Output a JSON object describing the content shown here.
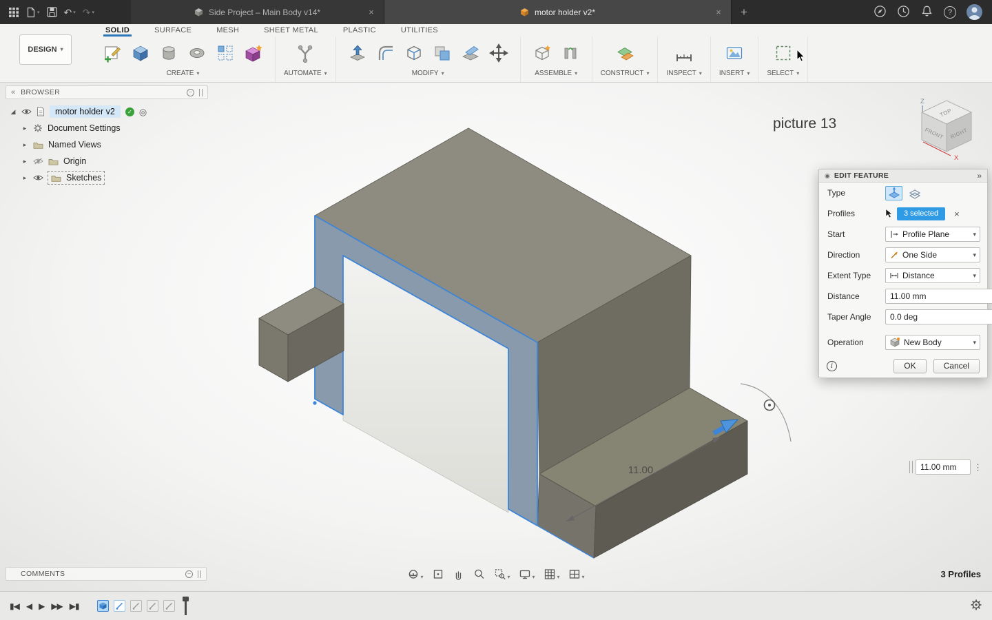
{
  "colors": {
    "accent": "#3c85d9",
    "selection_blue": "#2e9be4"
  },
  "glyphs": {
    "caret": "▾",
    "caret_right": "▸",
    "root_caret": "◢",
    "close": "×",
    "collapse_left": "«",
    "collapse_right": "»",
    "drag_dots": "⋮",
    "target": "◎",
    "check": "✓",
    "plus": "+",
    "help": "?",
    "undo": "↶",
    "redo": "↷",
    "record": "◉",
    "minus": "–"
  },
  "titlebar": {
    "tabs": [
      {
        "title": "Side Project – Main Body v14*"
      },
      {
        "title": "motor holder v2*"
      }
    ]
  },
  "ribbon": {
    "mode": "DESIGN",
    "tabs": [
      "SOLID",
      "SURFACE",
      "MESH",
      "SHEET METAL",
      "PLASTIC",
      "UTILITIES"
    ],
    "groups": [
      "CREATE",
      "AUTOMATE",
      "MODIFY",
      "ASSEMBLE",
      "CONSTRUCT",
      "INSPECT",
      "INSERT",
      "SELECT"
    ]
  },
  "browser": {
    "title": "BROWSER",
    "root_label": "motor holder v2",
    "items": [
      {
        "label": "Document Settings"
      },
      {
        "label": "Named Views"
      },
      {
        "label": "Origin"
      },
      {
        "label": "Sketches"
      }
    ]
  },
  "canvas": {
    "annotation": "picture 13",
    "dimension_label": "11.00",
    "offset_value": "11.00 mm",
    "profiles_status": "3 Profiles"
  },
  "viewcube": {
    "top": "TOP",
    "front": "FRONT",
    "right": "RIGHT",
    "axis_z": "Z",
    "axis_x": "X"
  },
  "dialog": {
    "title": "EDIT FEATURE",
    "type_label": "Type",
    "profiles_label": "Profiles",
    "profiles_badge": "3 selected",
    "start_label": "Start",
    "start_value": "Profile Plane",
    "direction_label": "Direction",
    "direction_value": "One Side",
    "extent_label": "Extent Type",
    "extent_value": "Distance",
    "distance_label": "Distance",
    "distance_value": "11.00 mm",
    "taper_label": "Taper Angle",
    "taper_value": "0.0 de g",
    "info_glyph": "i",
    "operation_label": "Operation",
    "operation_value": "New Body",
    "ok": "OK",
    "cancel": "Cancel"
  },
  "comments": {
    "title": "COMMENTS"
  },
  "timeline": {
    "skip_start": "▮◀",
    "step_back": "◀",
    "play": "▶",
    "step_fwd": "▶▶",
    "skip_end": "▶▮"
  }
}
